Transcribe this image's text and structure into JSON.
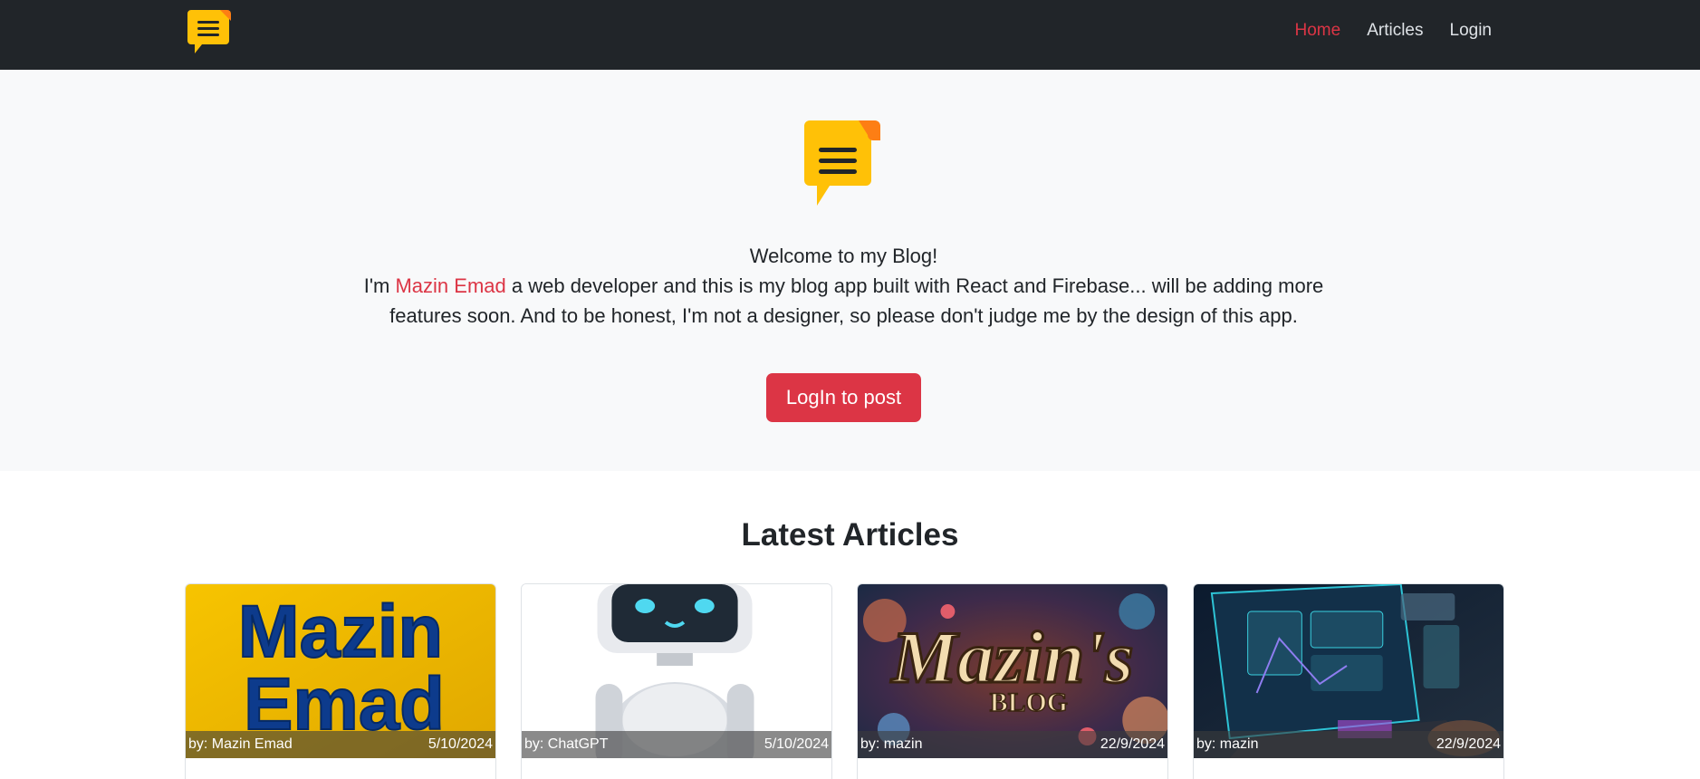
{
  "navbar": {
    "logo_icon": "note-icon",
    "links": [
      {
        "label": "Home",
        "active": true
      },
      {
        "label": "Articles",
        "active": false
      },
      {
        "label": "Login",
        "active": false
      }
    ]
  },
  "hero": {
    "logo_icon": "note-icon",
    "welcome": "Welcome to my Blog!",
    "intro_before": "I'm ",
    "intro_name": "Mazin Emad",
    "intro_after": " a web developer and this is my blog app built with React and Firebase... will be adding more features soon. And to be honest, I'm not a designer, so please don't judge me by the design of this app.",
    "button_label": "LogIn to post"
  },
  "articles": {
    "title": "Latest Articles",
    "cards": [
      {
        "author": "by: Mazin Emad",
        "date": "5/10/2024",
        "image_text_1": "Mazin",
        "image_text_2": "Emad"
      },
      {
        "author": "by: ChatGPT",
        "date": "5/10/2024"
      },
      {
        "author": "by: mazin",
        "date": "22/9/2024",
        "image_text_1": "Mazin's",
        "image_text_2": "BLOG"
      },
      {
        "author": "by: mazin",
        "date": "22/9/2024"
      }
    ]
  },
  "colors": {
    "accent": "#dc3545",
    "navbar_bg": "#212529",
    "hero_bg": "#f8f9fa",
    "logo_yellow": "#ffc107"
  }
}
